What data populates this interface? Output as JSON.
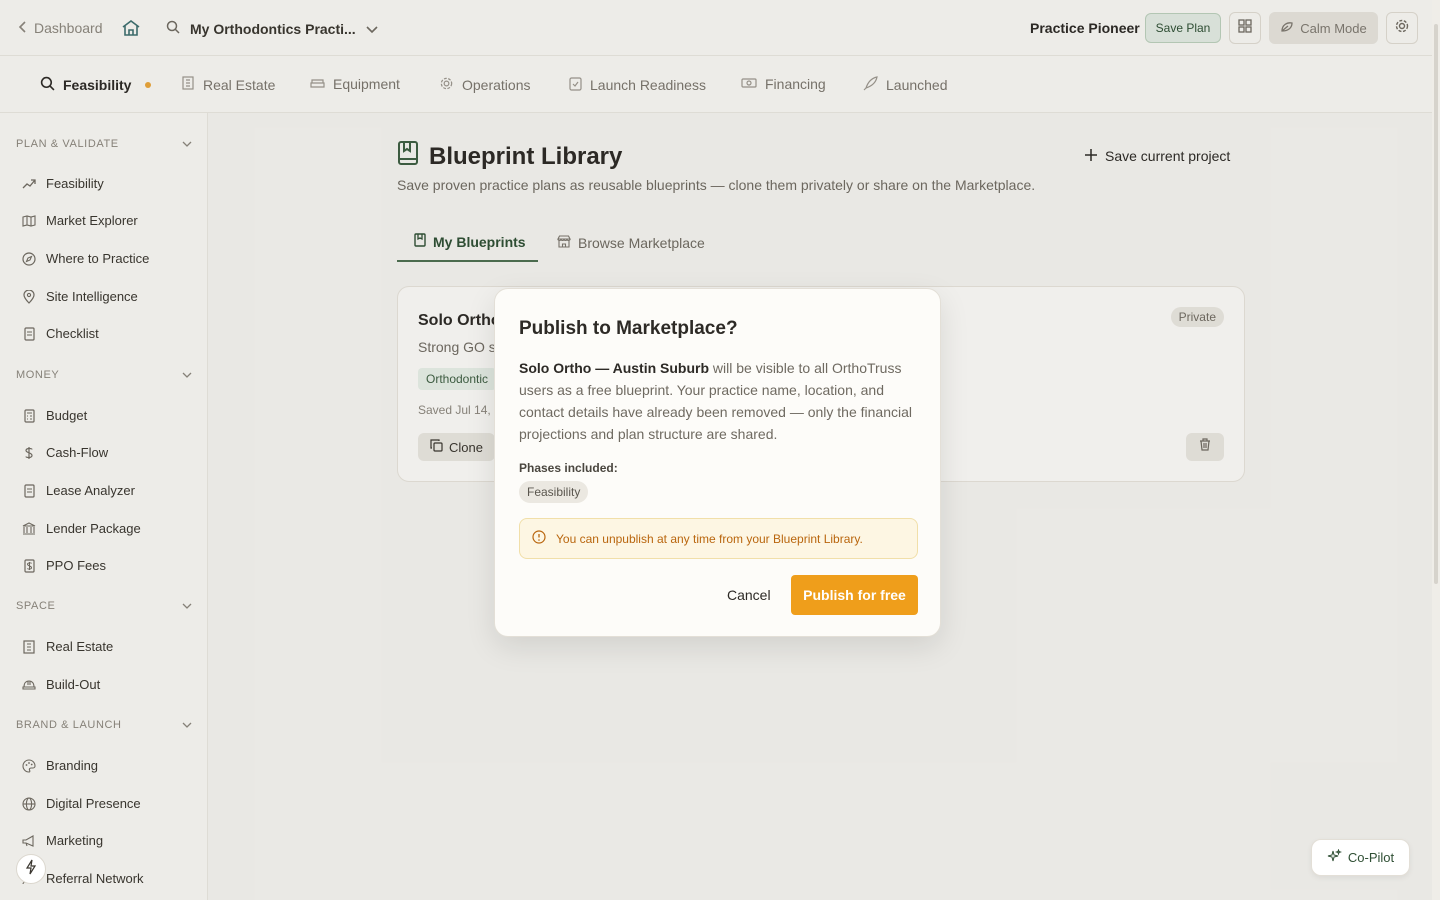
{
  "topbar": {
    "back_label": "Dashboard",
    "project_name": "My Orthodontics Practi...",
    "rank_label": "Practice Pioneer",
    "save_plan_label": "Save Plan",
    "calm_mode_label": "Calm Mode"
  },
  "phases": [
    {
      "label": "Feasibility",
      "icon": "search-icon",
      "active": true
    },
    {
      "label": "Real Estate",
      "icon": "building-icon"
    },
    {
      "label": "Equipment",
      "icon": "sofa-icon"
    },
    {
      "label": "Operations",
      "icon": "gear-icon"
    },
    {
      "label": "Launch Readiness",
      "icon": "clipboard-check-icon"
    },
    {
      "label": "Financing",
      "icon": "banknote-icon"
    },
    {
      "label": "Launched",
      "icon": "rocket-icon"
    }
  ],
  "sidebar": {
    "sections": [
      {
        "label": "PLAN & VALIDATE",
        "items": [
          "Feasibility",
          "Market Explorer",
          "Where to Practice",
          "Site Intelligence",
          "Checklist"
        ]
      },
      {
        "label": "MONEY",
        "items": [
          "Budget",
          "Cash-Flow",
          "Lease Analyzer",
          "Lender Package",
          "PPO Fees"
        ]
      },
      {
        "label": "SPACE",
        "items": [
          "Real Estate",
          "Build-Out"
        ]
      },
      {
        "label": "BRAND & LAUNCH",
        "items": [
          "Branding",
          "Digital Presence",
          "Marketing",
          "Referral Network"
        ]
      }
    ]
  },
  "main": {
    "title": "Blueprint Library",
    "subtitle": "Save proven practice plans as reusable blueprints — clone them privately or share on the Marketplace.",
    "save_current_label": "Save current project",
    "tabs": [
      {
        "label": "My Blueprints",
        "active": true
      },
      {
        "label": "Browse Marketplace"
      }
    ],
    "card": {
      "title": "Solo Ortho",
      "desc": "Strong GO s",
      "tag": "Orthodontic",
      "saved": "Saved Jul 14, 2",
      "clone_label": "Clone",
      "visibility": "Private"
    }
  },
  "modal": {
    "title": "Publish to Marketplace?",
    "blueprint_name": "Solo Ortho — Austin Suburb",
    "body_rest": " will be visible to all OrthoTruss users as a free blueprint. Your practice name, location, and contact details have already been removed — only the financial projections and plan structure are shared.",
    "phases_label": "Phases included:",
    "phase_chip": "Feasibility",
    "note": "You can unpublish at any time from your Blueprint Library.",
    "cancel_label": "Cancel",
    "publish_label": "Publish for free"
  },
  "copilot_label": "Co-Pilot",
  "colors": {
    "accent_green": "#2f4f34",
    "publish_orange": "#ef9e1b",
    "note_text": "#b9660e",
    "feasibility_dot": "#e7a33a"
  }
}
